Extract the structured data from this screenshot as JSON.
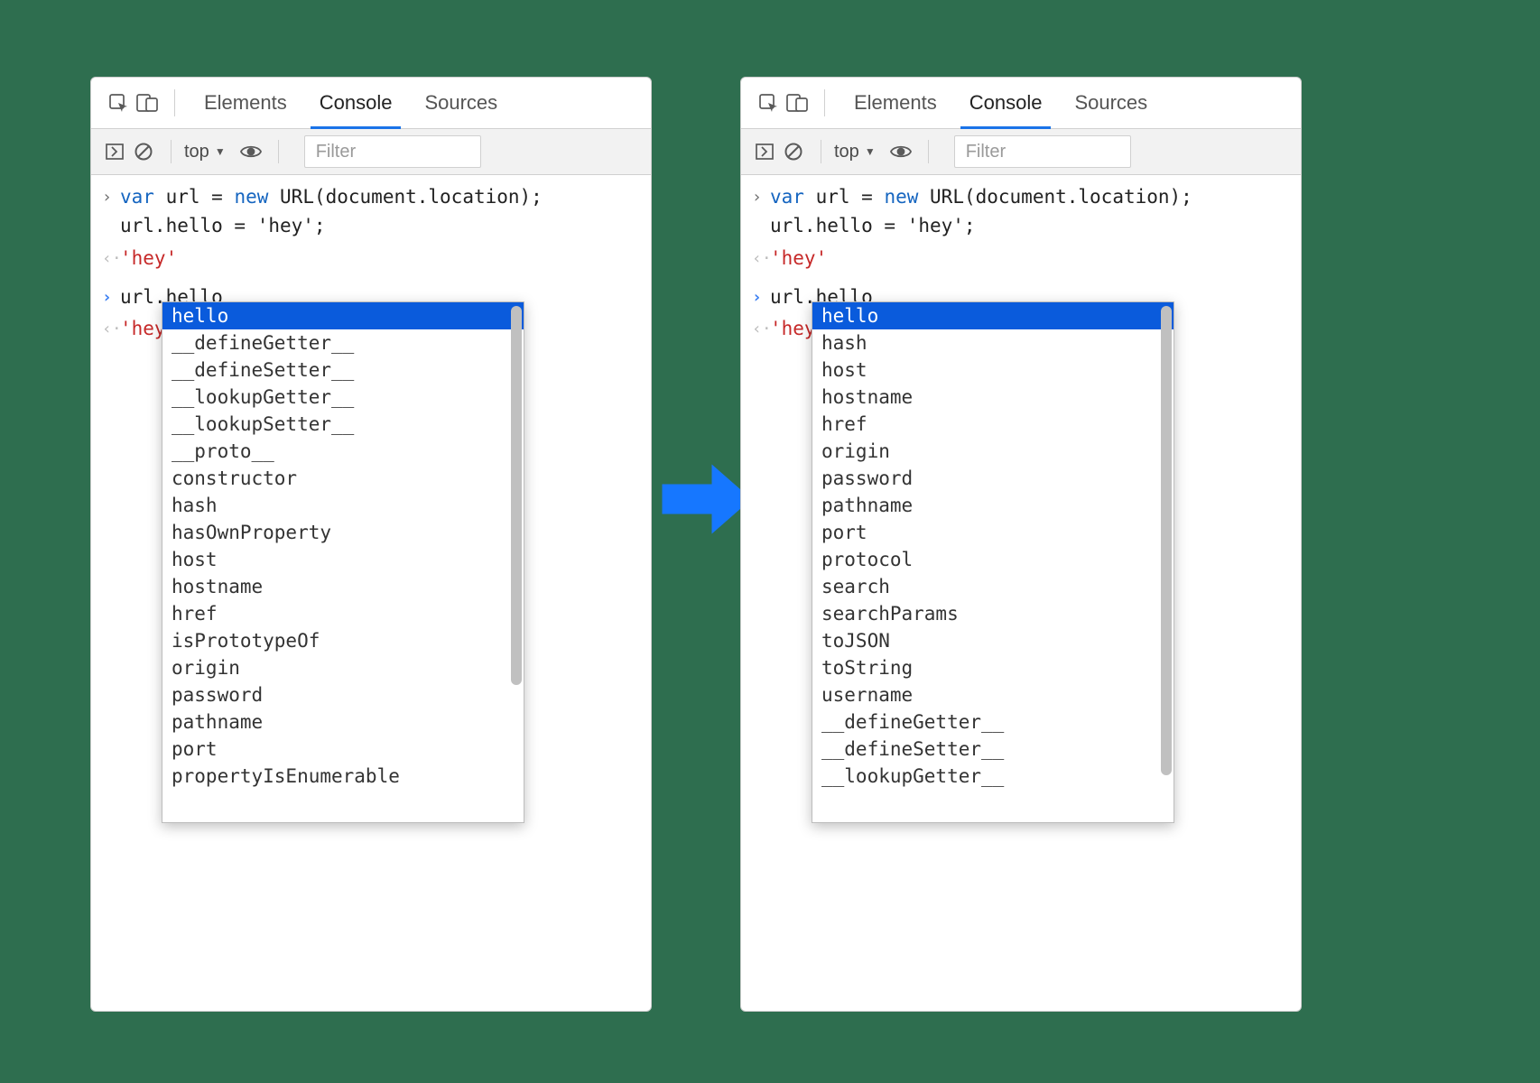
{
  "tabs": {
    "elements": "Elements",
    "console": "Console",
    "sources": "Sources"
  },
  "toolbar": {
    "context": "top",
    "filter_placeholder": "Filter"
  },
  "console": {
    "input1_line1_pre": "var",
    "input1_line1_mid": " url = ",
    "input1_line1_new": "new",
    "input1_line1_post": " URL(document.location);",
    "input1_line2": "url.hello = 'hey';",
    "output1": "'hey'",
    "input2": "url.hello",
    "output2": "'hey'"
  },
  "autocomplete_left": {
    "selected": "hello",
    "items": [
      "__defineGetter__",
      "__defineSetter__",
      "__lookupGetter__",
      "__lookupSetter__",
      "__proto__",
      "constructor",
      "hash",
      "hasOwnProperty",
      "host",
      "hostname",
      "href",
      "isPrototypeOf",
      "origin",
      "password",
      "pathname",
      "port",
      "propertyIsEnumerable"
    ]
  },
  "autocomplete_right": {
    "selected": "hello",
    "items": [
      "hash",
      "host",
      "hostname",
      "href",
      "origin",
      "password",
      "pathname",
      "port",
      "protocol",
      "search",
      "searchParams",
      "toJSON",
      "toString",
      "username",
      "__defineGetter__",
      "__defineSetter__",
      "__lookupGetter__"
    ]
  }
}
